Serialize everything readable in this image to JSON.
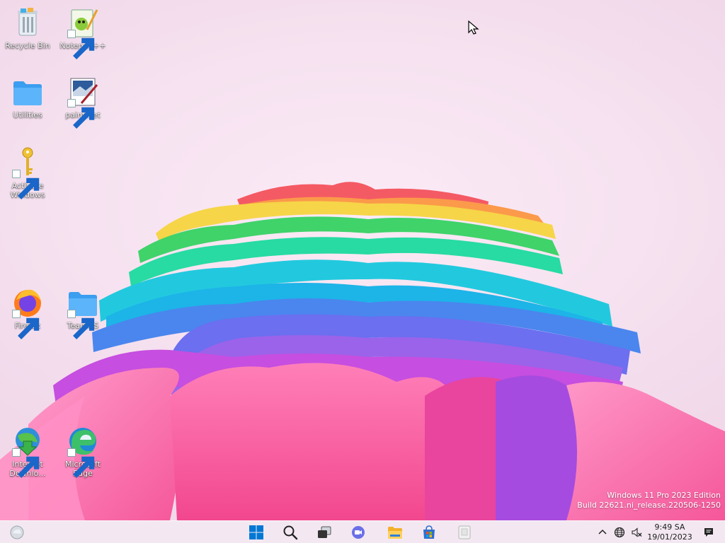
{
  "desktop": {
    "icons": [
      {
        "name": "recycle-bin",
        "label": "Recycle Bin"
      },
      {
        "name": "notepadpp",
        "label": "Notepad++"
      },
      {
        "name": "utilities",
        "label": "Utilities"
      },
      {
        "name": "paintnet",
        "label": "paint.net"
      },
      {
        "name": "activate-windows",
        "label": "Activate Windows"
      },
      {
        "name": "firefox",
        "label": "Firefox"
      },
      {
        "name": "teamos",
        "label": "TeamOS"
      },
      {
        "name": "internet-download-manager",
        "label": "Internet Downlo..."
      },
      {
        "name": "microsoft-edge",
        "label": "Microsoft Edge"
      }
    ]
  },
  "watermark": {
    "line1": "Windows 11 Pro 2023 Edition",
    "line2": "Build 22621.ni_release.220506-1250"
  },
  "taskbar": {
    "buttons": [
      "start-icon",
      "search-icon",
      "task-view-icon",
      "chat-icon",
      "file-explorer-icon",
      "microsoft-store-icon",
      "notepad-icon"
    ],
    "tray": [
      "chevron-up-icon",
      "globe-icon",
      "volume-muted-icon",
      "notification-icon"
    ],
    "clock": {
      "time": "9:49 SA",
      "date": "19/01/2023"
    }
  },
  "colors": {
    "accent": "#0078d4",
    "taskbar": "#f3e8f0"
  }
}
